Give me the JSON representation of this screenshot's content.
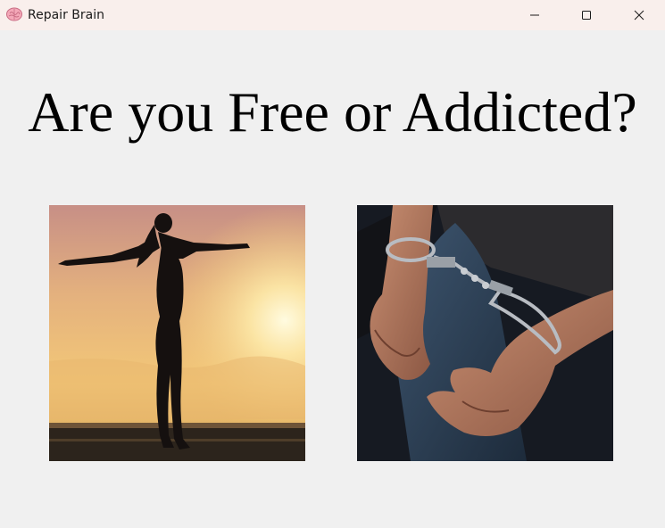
{
  "window": {
    "title": "Repair Brain",
    "app_icon": "brain-icon",
    "controls": [
      "minimize-icon",
      "maximize-icon",
      "close-icon"
    ]
  },
  "main": {
    "heading": "Are you Free or Addicted?",
    "images": [
      {
        "name": "free-woman-sunset-image",
        "subject": "silhouette-woman-arms-outstretched-sunset"
      },
      {
        "name": "addicted-handcuffs-image",
        "subject": "hands-handcuffed-behind-back"
      }
    ]
  },
  "colors": {
    "titlebar": "#f9efec",
    "background": "#f0f0f0",
    "text": "#000000"
  }
}
